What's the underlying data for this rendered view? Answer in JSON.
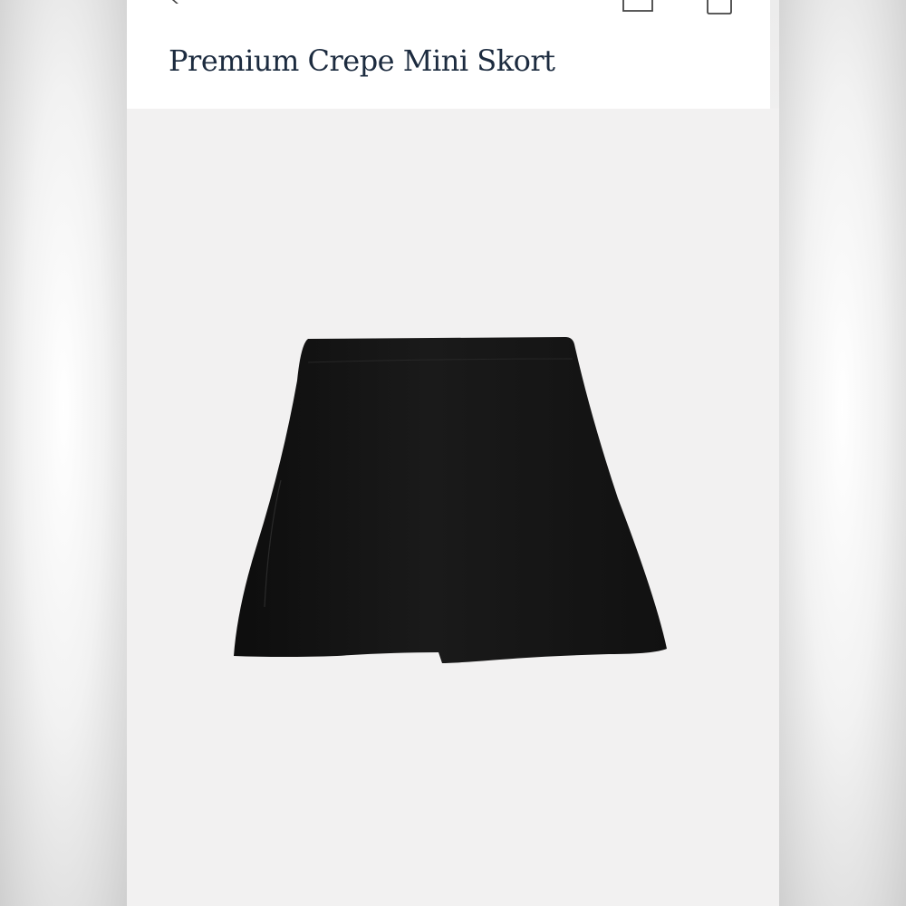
{
  "product": {
    "title": "Premium Crepe Mini Skort",
    "image": {
      "subject": "black mini skort",
      "background_color": "#f2f1f1",
      "garment_color": "#141414"
    }
  },
  "header": {
    "icons": [
      "back-chevron-icon",
      "account-icon",
      "shopping-bag-icon"
    ]
  },
  "colors": {
    "title_text": "#1c2b3f",
    "header_bg": "#ffffff",
    "page_bg": "#f3f2f2"
  }
}
